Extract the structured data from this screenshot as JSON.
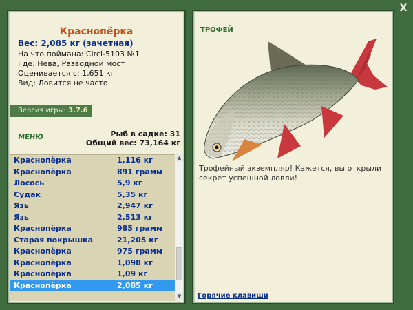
{
  "window": {
    "close_symbol": "X"
  },
  "fish_info": {
    "name": "Краснопёрка",
    "weight": "Вес: 2,085 кг (зачетная)",
    "caught_on": "На что поймана: Circl-5103 №1",
    "location": "Где: Нева, Разводной мост",
    "min_weight": "Оценивается с: 1,651 кг",
    "rarity": "Вид: Ловится не часто"
  },
  "version": {
    "label": "Версия игры:",
    "number": "3.7.6"
  },
  "menu": {
    "label": "МЕНЮ"
  },
  "cage": {
    "fish_count": "Рыб в садке: 31",
    "total_weight": "Общий вес: 73,164 кг"
  },
  "catch_list": [
    {
      "name": "Краснопёрка",
      "weight": "1,116 кг"
    },
    {
      "name": "Краснопёрка",
      "weight": "891 грамм"
    },
    {
      "name": "Лосось",
      "weight": "5,9 кг"
    },
    {
      "name": "Судак",
      "weight": "5,35 кг"
    },
    {
      "name": "Язь",
      "weight": "2,947 кг"
    },
    {
      "name": "Язь",
      "weight": "2,513 кг"
    },
    {
      "name": "Краснопёрка",
      "weight": "985 грамм"
    },
    {
      "name": "Старая покрышка",
      "weight": "21,205 кг"
    },
    {
      "name": "Краснопёрка",
      "weight": "975 грамм"
    },
    {
      "name": "Краснопёрка",
      "weight": "1,098 кг"
    },
    {
      "name": "Краснопёрка",
      "weight": "1,09 кг"
    },
    {
      "name": "Краснопёрка",
      "weight": "2,085 кг"
    }
  ],
  "trophy": {
    "label": "ТРОФЕЙ",
    "message": "Трофейный экземпляр! Кажется, вы открыли секрет успешной ловли!"
  },
  "hotkeys": {
    "label": "Горячие клавиши"
  },
  "colors": {
    "background": "#3f6b3e",
    "panel": "#f2f0db",
    "list_bg": "#d8d4b4",
    "selection": "#3399f0",
    "title_orange": "#c0521d",
    "link_blue": "#0a2f8f"
  }
}
